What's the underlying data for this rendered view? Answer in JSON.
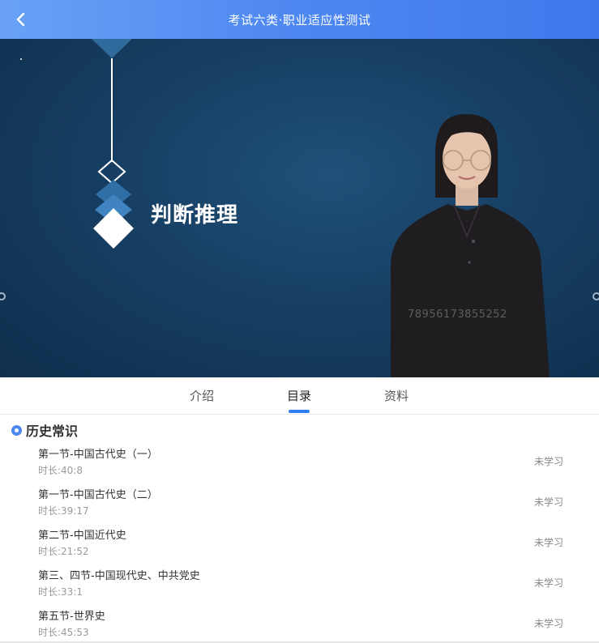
{
  "header": {
    "title": "考试六类·职业适应性测试",
    "back_icon": "chevron-left-icon"
  },
  "video": {
    "slide_title": "判断推理",
    "watermark": "78956173855252"
  },
  "tabs": [
    {
      "label": "介绍",
      "active": false
    },
    {
      "label": "目录",
      "active": true
    },
    {
      "label": "资料",
      "active": false
    }
  ],
  "catalog": {
    "section_title": "历史常识",
    "lessons": [
      {
        "title": "第一节-中国古代史（一）",
        "duration": "时长:40:8",
        "status": "未学习"
      },
      {
        "title": "第一节-中国古代史（二）",
        "duration": "时长:39:17",
        "status": "未学习"
      },
      {
        "title": "第二节-中国近代史",
        "duration": "时长:21:52",
        "status": "未学习"
      },
      {
        "title": "第三、四节-中国现代史、中共党史",
        "duration": "时长:33:1",
        "status": "未学习"
      },
      {
        "title": "第五节-世界史",
        "duration": "时长:45:53",
        "status": "未学习"
      }
    ]
  },
  "colors": {
    "accent": "#2f7df0",
    "header_gradient_start": "#6aa1f6",
    "header_gradient_end": "#3f78ec",
    "video_background": "#173f63"
  }
}
